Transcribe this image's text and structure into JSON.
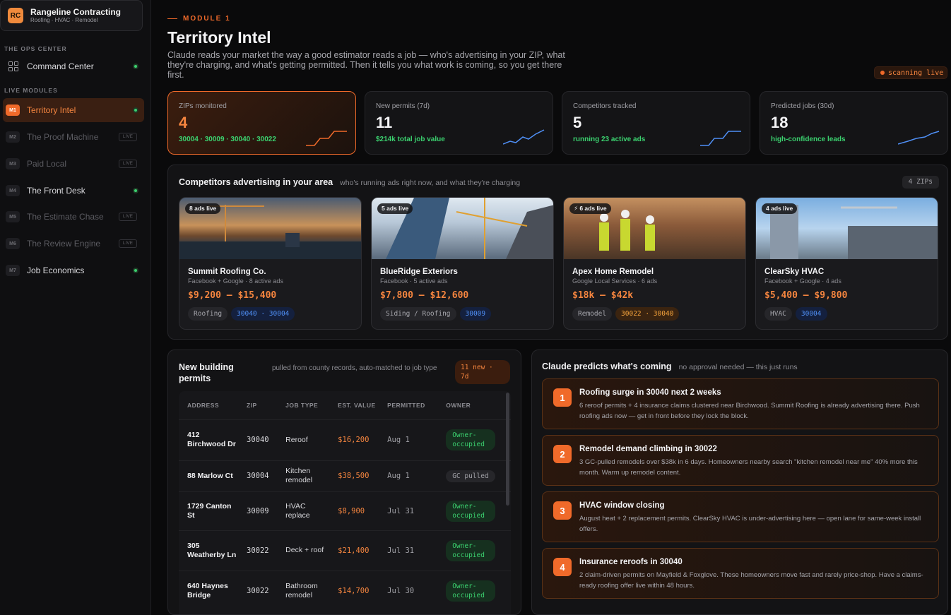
{
  "brand": {
    "initials": "RC",
    "name": "Rangeline Contracting",
    "sub": "Roofing · HVAC · Remodel"
  },
  "sidebar": {
    "ops_title": "THE OPS CENTER",
    "command_center": "Command Center",
    "live_title": "LIVE MODULES",
    "items": [
      {
        "code": "M1",
        "label": "Territory Intel"
      },
      {
        "code": "M2",
        "label": "The Proof Machine",
        "pill": "LIVE"
      },
      {
        "code": "M3",
        "label": "Paid Local",
        "pill": "LIVE"
      },
      {
        "code": "M4",
        "label": "The Front Desk"
      },
      {
        "code": "M5",
        "label": "The Estimate Chase",
        "pill": "LIVE"
      },
      {
        "code": "M6",
        "label": "The Review Engine",
        "pill": "LIVE"
      },
      {
        "code": "M7",
        "label": "Job Economics"
      }
    ]
  },
  "header": {
    "module": "MODULE 1",
    "title": "Territory Intel",
    "intro": "Claude reads your market the way a good estimator reads a job — who's advertising in your ZIP, what they're charging, and what's getting permitted. Then it tells you what work is coming, so you get there first.",
    "scan": "scanning live"
  },
  "stats": [
    {
      "label": "ZIPs monitored",
      "value": "4",
      "sub": "30004 · 30009 · 30040 · 30022"
    },
    {
      "label": "New permits (7d)",
      "value": "11",
      "sub": "$214k total job value"
    },
    {
      "label": "Competitors tracked",
      "value": "5",
      "sub": "running 23 active ads"
    },
    {
      "label": "Predicted jobs (30d)",
      "value": "18",
      "sub": "high-confidence leads"
    }
  ],
  "competitors_panel": {
    "title": "Competitors advertising in your area",
    "subtitle": "who's running ads right now, and what they're charging",
    "badge": "4 ZIPs"
  },
  "competitors": [
    {
      "ads": "8 ads live",
      "name": "Summit Roofing Co.",
      "meta": "Facebook + Google · 8 active ads",
      "price": "$9,200 – $15,400",
      "tag": "Roofing",
      "zips": "30040 · 30004"
    },
    {
      "ads": "5 ads live",
      "name": "BlueRidge Exteriors",
      "meta": "Facebook · 5 active ads",
      "price": "$7,800 – $12,600",
      "tag": "Siding / Roofing",
      "zips": "30009"
    },
    {
      "ads": "⚡ 6 ads live",
      "name": "Apex Home Remodel",
      "meta": "Google Local Services · 6 ads",
      "price": "$18k – $42k",
      "tag": "Remodel",
      "zips": "30022 · 30040"
    },
    {
      "ads": "4 ads live",
      "name": "ClearSky HVAC",
      "meta": "Facebook + Google · 4 ads",
      "price": "$5,400 – $9,800",
      "tag": "HVAC",
      "zips": "30004"
    }
  ],
  "permits": {
    "title": "New building permits",
    "subtitle": "pulled from county records, auto-matched to job type",
    "badge": "11 new · 7d",
    "headers": [
      "ADDRESS",
      "ZIP",
      "JOB TYPE",
      "EST. VALUE",
      "PERMITTED",
      "OWNER"
    ],
    "rows": [
      {
        "address": "412 Birchwood Dr",
        "zip": "30040",
        "job": "Reroof",
        "value": "$16,200",
        "date": "Aug 1",
        "owner": "Owner-occupied"
      },
      {
        "address": "88 Marlow Ct",
        "zip": "30004",
        "job": "Kitchen remodel",
        "value": "$38,500",
        "date": "Aug 1",
        "owner": "GC pulled"
      },
      {
        "address": "1729 Canton St",
        "zip": "30009",
        "job": "HVAC replace",
        "value": "$8,900",
        "date": "Jul 31",
        "owner": "Owner-occupied"
      },
      {
        "address": "305 Weatherby Ln",
        "zip": "30022",
        "job": "Deck + roof",
        "value": "$21,400",
        "date": "Jul 31",
        "owner": "Owner-occupied"
      },
      {
        "address": "640 Haynes Bridge",
        "zip": "30022",
        "job": "Bathroom remodel",
        "value": "$14,700",
        "date": "Jul 30",
        "owner": "Owner-occupied"
      }
    ]
  },
  "predictions": {
    "title": "Claude predicts what's coming",
    "subtitle": "no approval needed — this just runs",
    "items": [
      {
        "num": "1",
        "title": "Roofing surge in 30040 next 2 weeks",
        "desc": "6 reroof permits + 4 insurance claims clustered near Birchwood. Summit Roofing is already advertising there. Push roofing ads now — get in front before they lock the block."
      },
      {
        "num": "2",
        "title": "Remodel demand climbing in 30022",
        "desc": "3 GC-pulled remodels over $38k in 6 days. Homeowners nearby search \"kitchen remodel near me\" 40% more this month. Warm up remodel content."
      },
      {
        "num": "3",
        "title": "HVAC window closing",
        "desc": "August heat + 2 replacement permits. ClearSky HVAC is under-advertising here — open lane for same-week install offers."
      },
      {
        "num": "4",
        "title": "Insurance reroofs in 30040",
        "desc": "2 claim-driven permits on Mayfield & Foxglove. These homeowners move fast and rarely price-shop. Have a claims-ready roofing offer live within 48 hours."
      }
    ]
  },
  "colors": {
    "accent": "#f06a2a",
    "green": "#3bd16f",
    "blue": "#4f8ff5"
  }
}
